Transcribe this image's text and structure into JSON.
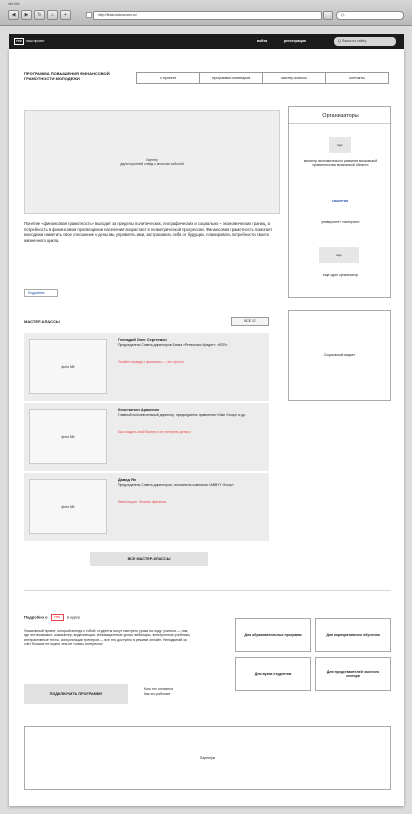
{
  "browser": {
    "title": "site title",
    "address": "http://financialcourses.ru/",
    "search_placeholder": "Q-",
    "buttons": [
      "◀",
      "▶",
      "↻",
      "⌂",
      "+"
    ]
  },
  "topbar": {
    "logo_badge": "ГРК",
    "logo_text": "наш проект",
    "nav": [
      "войти",
      "регистрация"
    ],
    "search_placeholder": "Q Поиск по сайту"
  },
  "header": {
    "title": "ПРОГРАММА ПОВЫШЕНИЯ ФИНАНСОВОЙ ГРАМОТНОСТИ МОЛОДЕЖИ",
    "tabs": [
      "о проекте",
      "программа семинаров",
      "мастер-классы",
      "контакты"
    ]
  },
  "hero": {
    "caption": "Баннер\nдвухсторонний слайд с анонсом событий"
  },
  "intro": {
    "text": "Понятие «финансовая грамотность» выходит за пределы политических, географических и социально – экономических границ, а потребность в финансовом просвещении населения возрастает в геометрической прогрессии. Финансовая грамотность помогает молодежи наметить свое отношение к деньгам, управлять ими, застраховать себя от будущих, планировать потребности своего жизненного цикла.",
    "more": "Подробнее"
  },
  "organizers": {
    "title": "Организаторы",
    "items": [
      {
        "logo": "logo",
        "caption": "министр экономического развития московской правительства московской области"
      },
      {
        "logo": "СИНЕРГИЯ",
        "caption": "университет «синергия»"
      },
      {
        "logo": "logo",
        "caption": "еще один организатор"
      }
    ]
  },
  "masterclasses": {
    "title": "МАСТЕР-КЛАССЫ",
    "all_button": "ВСЕ 12",
    "items": [
      {
        "thumb": "фото МК",
        "name": "Геннадий Олег Сергеевич",
        "desc": "Председатель Совета директоров Банка «Ренессанс Кредит», «ВТБ»",
        "link": "Узнайте правду о финансах — это просто"
      },
      {
        "thumb": "фото МК",
        "name": "Константин Аракелян",
        "desc": "Главный исполнительный директор, председатель правления «Sale Group» и др.",
        "link": "Как создать свой бизнес и не потерять деньги"
      },
      {
        "thumb": "фото МК",
        "name": "Давид Ян",
        "desc": "Председатель Совета директоров, основатель компании «ABBYY Group»",
        "link": "Инвестиции. Личные финансы"
      }
    ],
    "all_masterclasses": "ВСЕ МАСТЕР-КЛАССЫ"
  },
  "social": {
    "label": "Социальный виджет"
  },
  "about": {
    "title_prefix": "Подробно о",
    "title_logo": "ГРК",
    "title_suffix": "в курсе",
    "text": "Уникальный проект, который всегда с тобой: студенты могут смотреть уроки на ходу: учиться — там, где это возможно: компьютер, видеолекции, инновационные уроки, вебинары, электронные учебники, интерактивные тесты, консультации тренеров — все это доступно в режиме онлайн. Неподвигай за счет больше не нужно чем не только интересно!",
    "subscribe": "ПОДКЛЮЧИТЬ ПРОГРАММУ",
    "links": [
      "Кого это готовится",
      "Как это работает"
    ]
  },
  "audience_buttons": [
    "Для образовательных программ",
    "Для корпоративного обучения",
    "Для вузов студентов",
    "Для представителей частного сектора"
  ],
  "partners": {
    "label": "Партнеры"
  },
  "colors": {
    "accent": "#e8484a",
    "topbar": "#1c1c1c",
    "link": "#1a47a6"
  }
}
